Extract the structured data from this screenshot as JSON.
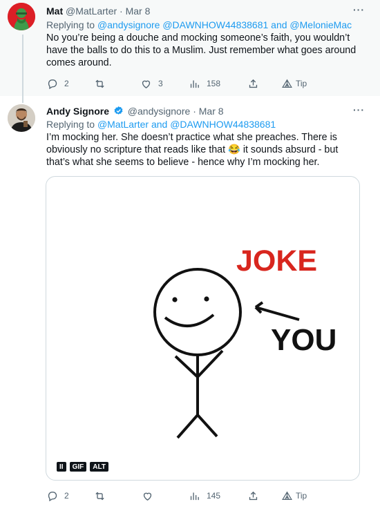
{
  "tweets": [
    {
      "name": "Mat",
      "handle": "@MatLarter",
      "separator": "·",
      "date": "Mar 8",
      "replying_prefix": "Replying to",
      "replying_to": "@andysignore @DAWNHOW44838681 and @MelonieMac",
      "text": "No you’re being a douche and mocking someone’s faith, you wouldn’t have the balls to do this to a Muslim. Just remember what goes around comes around.",
      "more": "···",
      "stats": {
        "replies": "2",
        "retweets": "",
        "likes": "3",
        "views": "158",
        "tip": "Tip"
      },
      "avatar_color": "#dc1f26"
    },
    {
      "name": "Andy Signore",
      "handle": "@andysignore",
      "separator": "·",
      "date": "Mar 8",
      "replying_prefix": "Replying to",
      "replying_to": "@MatLarter and @DAWNHOW44838681",
      "text": "I’m mocking her. She doesn’t practice what she preaches. There is obviously no scripture that reads like that 😂  it sounds absurd - but that’s what she seems to believe - hence why I’m mocking her.",
      "more": "···",
      "verified": true,
      "media": {
        "joke_text": "JOKE",
        "you_text": "YOU",
        "badges": [
          "II",
          "GIF",
          "ALT"
        ]
      },
      "stats": {
        "replies": "2",
        "retweets": "",
        "likes": "",
        "views": "145",
        "tip": "Tip"
      }
    }
  ],
  "colors": {
    "link": "#1d9bf0",
    "muted": "#536471",
    "joke_red": "#d8261e",
    "verified": "#1d9bf0",
    "thread_line": "#cfd9de"
  }
}
